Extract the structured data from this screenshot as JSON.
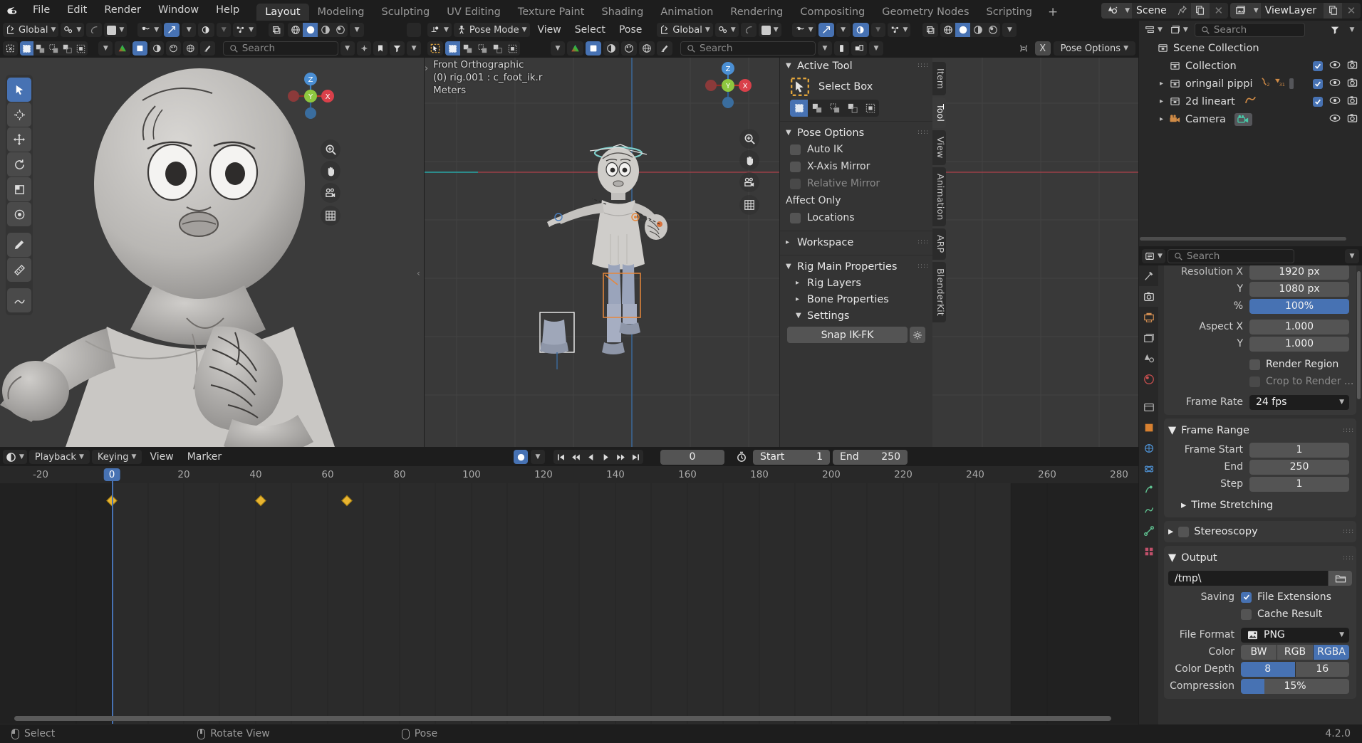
{
  "app": {
    "version": "4.2.0"
  },
  "topbar": {
    "menus": [
      "File",
      "Edit",
      "Render",
      "Window",
      "Help"
    ],
    "workspace_tabs": [
      "Layout",
      "Modeling",
      "Sculpting",
      "UV Editing",
      "Texture Paint",
      "Shading",
      "Animation",
      "Rendering",
      "Compositing",
      "Geometry Nodes",
      "Scripting"
    ],
    "active_workspace": "Layout",
    "add_tab": "+",
    "scene_name": "Scene",
    "viewlayer_name": "ViewLayer"
  },
  "viewport_left": {
    "transform_orientation": "Global",
    "search_placeholder": "Search"
  },
  "viewport_right": {
    "mode": "Pose Mode",
    "menus": [
      "View",
      "Select",
      "Pose"
    ],
    "transform_orientation": "Global",
    "search_placeholder": "Search",
    "pose_options_label": "Pose Options",
    "overlay_text": {
      "view": "Front Orthographic",
      "object": "(0) rig.001 : c_foot_ik.r",
      "units": "Meters"
    },
    "gizmo_axes": {
      "z": "Z",
      "y": "Y",
      "x": "X"
    }
  },
  "npanel": {
    "tabs": [
      "Item",
      "Tool",
      "View",
      "Animation",
      "ARP",
      "BlenderKit"
    ],
    "active_tab": "Tool",
    "sections": {
      "active_tool": {
        "title": "Active Tool",
        "tool_name": "Select Box"
      },
      "pose_options": {
        "title": "Pose Options",
        "auto_ik": "Auto IK",
        "x_axis_mirror": "X-Axis Mirror",
        "relative_mirror": "Relative Mirror",
        "affect_only": "Affect Only",
        "locations": "Locations"
      },
      "workspace": {
        "title": "Workspace"
      },
      "rig_main_properties": {
        "title": "Rig Main Properties",
        "rig_layers": "Rig Layers",
        "bone_properties": "Bone Properties",
        "settings": "Settings",
        "snap_ik_fk": "Snap IK-FK"
      }
    }
  },
  "outliner": {
    "search_placeholder": "Search",
    "rows": [
      {
        "label": "Scene Collection",
        "indent": 0,
        "twisty": "",
        "icon": "collection-icon",
        "checkbox": null,
        "eye": false,
        "camera": false
      },
      {
        "label": "Collection",
        "indent": 1,
        "twisty": "",
        "icon": "collection-icon",
        "checkbox": true,
        "eye": true,
        "camera": true
      },
      {
        "label": "oringail pippi",
        "indent": 1,
        "twisty": "›",
        "icon": "collection-icon",
        "checkbox": true,
        "eye": true,
        "camera": true,
        "badges": [
          "armature-2",
          "mesh-31"
        ]
      },
      {
        "label": "2d lineart",
        "indent": 1,
        "twisty": "›",
        "icon": "collection-icon",
        "checkbox": true,
        "eye": true,
        "camera": true,
        "badges": [
          "grease-pencil"
        ]
      },
      {
        "label": "Camera",
        "indent": 1,
        "twisty": "›",
        "icon": "camera-icon",
        "checkbox": null,
        "eye": true,
        "camera": true,
        "badges": [
          "camera-data"
        ]
      }
    ]
  },
  "properties": {
    "search_placeholder": "Search",
    "format": {
      "resolution_x_label": "Resolution X",
      "resolution_x_value": "1920 px",
      "resolution_y_label": "Y",
      "resolution_y_value": "1080 px",
      "percent_label": "%",
      "percent_value": "100%",
      "aspect_x_label": "Aspect X",
      "aspect_x_value": "1.000",
      "aspect_y_label": "Y",
      "aspect_y_value": "1.000",
      "render_region": "Render Region",
      "crop_to_render": "Crop to Render ...",
      "frame_rate_label": "Frame Rate",
      "frame_rate_value": "24 fps"
    },
    "frame_range": {
      "title": "Frame Range",
      "frame_start_label": "Frame Start",
      "frame_start_value": "1",
      "end_label": "End",
      "end_value": "250",
      "step_label": "Step",
      "step_value": "1",
      "time_stretching": "Time Stretching"
    },
    "stereoscopy": {
      "title": "Stereoscopy"
    },
    "output": {
      "title": "Output",
      "path_value": "/tmp\\",
      "saving_label": "Saving",
      "file_extensions": "File Extensions",
      "cache_result": "Cache Result",
      "file_format_label": "File Format",
      "file_format_value": "PNG",
      "color_label": "Color",
      "color_options": [
        "BW",
        "RGB",
        "RGBA"
      ],
      "color_active": "RGBA",
      "color_depth_label": "Color Depth",
      "color_depth_options": [
        "8",
        "16"
      ],
      "color_depth_active": "8",
      "compression_label": "Compression",
      "compression_value": "15%"
    }
  },
  "timeline": {
    "menus": [
      "Playback",
      "Keying",
      "View",
      "Marker"
    ],
    "current_frame": "0",
    "start_label": "Start",
    "start_value": "1",
    "end_label": "End",
    "end_value": "250",
    "ruler_ticks": [
      "-20",
      "0",
      "20",
      "40",
      "60",
      "80",
      "100",
      "120",
      "140",
      "160",
      "180",
      "200",
      "220",
      "240",
      "260",
      "280"
    ],
    "playhead_frame": "0",
    "keyframes": [
      0,
      26,
      38
    ]
  },
  "status": {
    "items": [
      {
        "mouse": "left",
        "label": "Select"
      },
      {
        "mouse": "middle",
        "label": "Rotate View"
      },
      {
        "mouse": "right",
        "label": "Pose"
      }
    ],
    "version": "4.2.0"
  }
}
